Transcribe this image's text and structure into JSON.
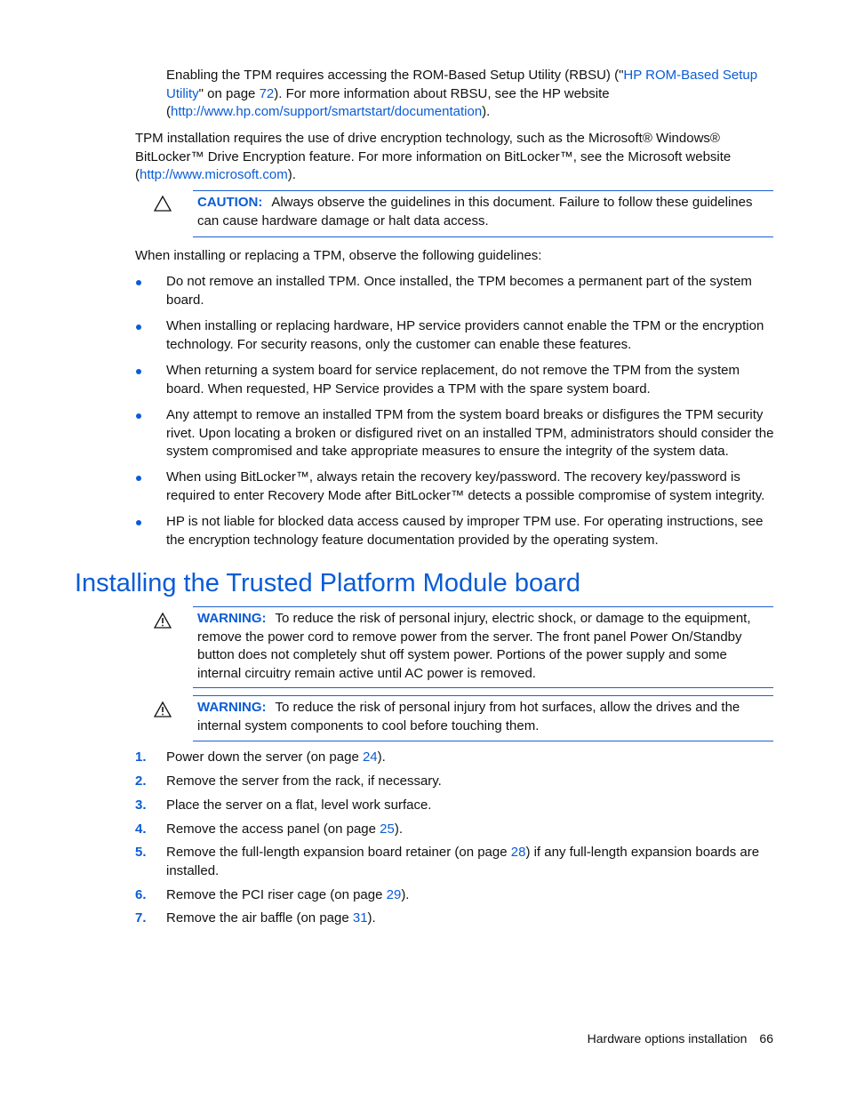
{
  "intro": {
    "p1_a": "Enabling the TPM requires accessing the ROM-Based Setup Utility (RBSU) (\"",
    "p1_link": "HP ROM-Based Setup Utility",
    "p1_b": "\" on page ",
    "p1_page": "72",
    "p1_c": "). For more information about RBSU, see the HP website (",
    "p1_url": "http://www.hp.com/support/smartstart/documentation",
    "p1_d": ").",
    "p2_a": "TPM installation requires the use of drive encryption technology, such as the Microsoft® Windows® BitLocker™ Drive Encryption feature. For more information on BitLocker™, see the Microsoft website (",
    "p2_url": "http://www.microsoft.com",
    "p2_b": ")."
  },
  "caution": {
    "label": "CAUTION:",
    "text": "Always observe the guidelines in this document. Failure to follow these guidelines can cause hardware damage or halt data access."
  },
  "guidelines_intro": "When installing or replacing a TPM, observe the following guidelines:",
  "guidelines": [
    "Do not remove an installed TPM. Once installed, the TPM becomes a permanent part of the system board.",
    "When installing or replacing hardware, HP service providers cannot enable the TPM or the encryption technology. For security reasons, only the customer can enable these features.",
    "When returning a system board for service replacement, do not remove the TPM from the system board. When requested, HP Service provides a TPM with the spare system board.",
    "Any attempt to remove an installed TPM from the system board breaks or disfigures the TPM security rivet. Upon locating a broken or disfigured rivet on an installed TPM, administrators should consider the system compromised and take appropriate measures to ensure the integrity of the system data.",
    "When using BitLocker™, always retain the recovery key/password. The recovery key/password is required to enter Recovery Mode after BitLocker™ detects a possible compromise of system integrity.",
    "HP is not liable for blocked data access caused by improper TPM use. For operating instructions, see the encryption technology feature documentation provided by the operating system."
  ],
  "section": {
    "title": "Installing the Trusted Platform Module board",
    "warnings": [
      {
        "label": "WARNING:",
        "text": "To reduce the risk of personal injury, electric shock, or damage to the equipment, remove the power cord to remove power from the server. The front panel Power On/Standby button does not completely shut off system power. Portions of the power supply and some internal circuitry remain active until AC power is removed."
      },
      {
        "label": "WARNING:",
        "text": "To reduce the risk of personal injury from hot surfaces, allow the drives and the internal system components to cool before touching them."
      }
    ],
    "steps": [
      {
        "num": "1.",
        "text": "Power down the server (on page ",
        "page": "24",
        "after": ")."
      },
      {
        "num": "2.",
        "text": "Remove the server from the rack, if necessary.",
        "page": null,
        "after": ""
      },
      {
        "num": "3.",
        "text": "Place the server on a flat, level work surface.",
        "page": null,
        "after": ""
      },
      {
        "num": "4.",
        "text": "Remove the access panel (on page ",
        "page": "25",
        "after": ")."
      },
      {
        "num": "5.",
        "text": "Remove the full-length expansion board retainer (on page ",
        "page": "28",
        "after": ") if any full-length expansion boards are installed."
      },
      {
        "num": "6.",
        "text": "Remove the PCI riser cage (on page ",
        "page": "29",
        "after": ")."
      },
      {
        "num": "7.",
        "text": "Remove the air baffle (on page ",
        "page": "31",
        "after": ")."
      }
    ]
  },
  "footer": {
    "section": "Hardware options installation",
    "page": "66"
  }
}
